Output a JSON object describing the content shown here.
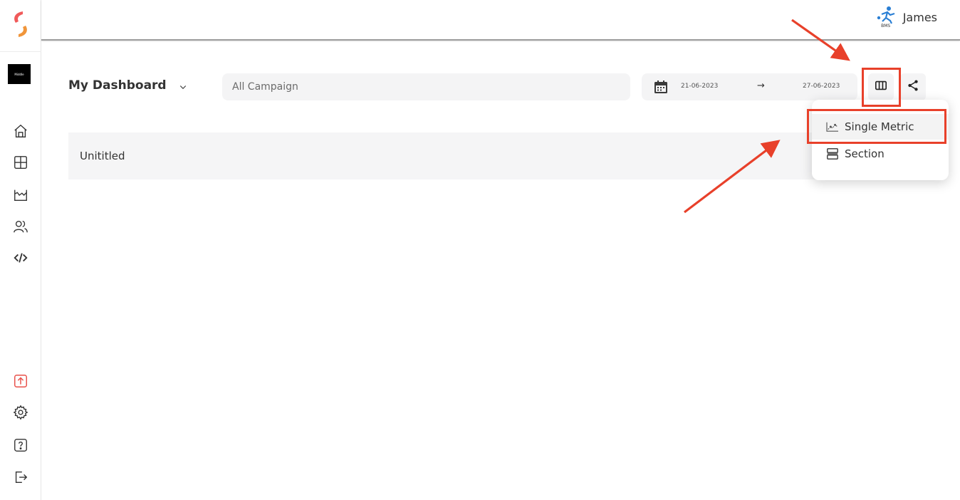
{
  "sidebar": {
    "logo_icon": "brand-logo",
    "brand_chip_text": "Middle",
    "nav": [
      {
        "icon": "home-icon"
      },
      {
        "icon": "dashboard-grid-icon"
      },
      {
        "icon": "analytics-chart-icon"
      },
      {
        "icon": "users-icon"
      },
      {
        "icon": "code-icon"
      }
    ],
    "bottom": [
      {
        "icon": "upload-icon"
      },
      {
        "icon": "settings-gear-icon"
      },
      {
        "icon": "help-icon"
      },
      {
        "icon": "logout-icon"
      }
    ]
  },
  "header": {
    "user_name": "James",
    "avatar_text": "BMS"
  },
  "toolbar": {
    "dashboard_name": "My Dashboard",
    "campaign_placeholder": "All Campaign",
    "date_start": "21-06-2023",
    "date_arrow": "→",
    "date_end": "27-06-2023"
  },
  "section": {
    "title": "Unititled"
  },
  "add_menu": {
    "items": [
      {
        "label": "Single Metric",
        "icon": "line-chart-icon"
      },
      {
        "label": "Section",
        "icon": "section-rows-icon"
      }
    ]
  },
  "colors": {
    "accent_red": "#e8402a",
    "panel_bg": "#f4f4f5",
    "text": "#333333"
  }
}
